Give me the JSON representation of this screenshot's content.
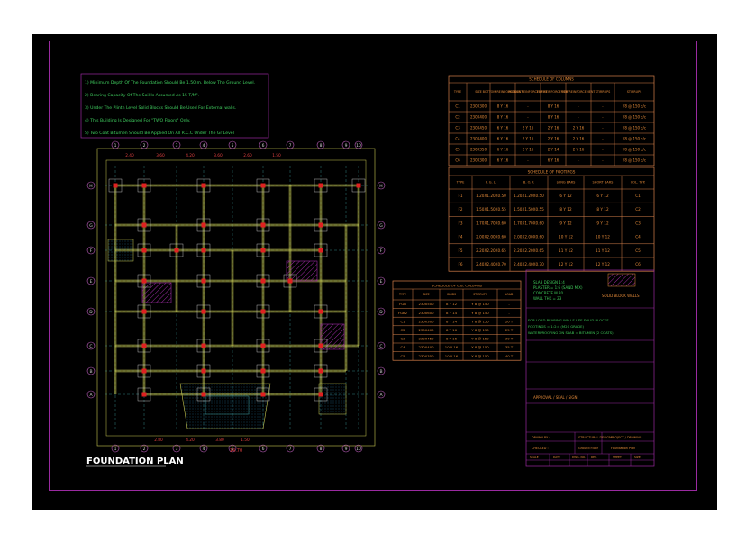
{
  "drawing": {
    "title": "FOUNDATION PLAN"
  },
  "notes": [
    "1)  Minimum Depth Of The Foundation Should Be 1.50 m. Below The Ground Level.",
    "2)  Bearing Capacity Of The Soil Is Assumed As 15 T/M².",
    "3)  Under The Plinth Level Solid Blocks Should Be Used For External walls.",
    "4)  This Building Is Designed For \"TWO Floors\" Only.",
    "5)  Two Coat Bitumen Should Be Applied On All R.C.C Under The Gr Level"
  ],
  "column_schedule": {
    "title": "SCHEDULE OF COLUMNS",
    "headers": [
      "TYPE",
      "SIZE",
      "BOTTOM REINFORCEMENT",
      "MIDDLE REINFORCEMENT",
      "TOP REINFORCEMENT",
      "TOP REINFORCEMENT",
      "STIRRUPS",
      "STIRRUPS"
    ],
    "rows": [
      [
        "C1",
        "230X300",
        "8 Y 16",
        "-",
        "8 Y 16",
        "-",
        "-",
        "Y8 @ 150 c/c"
      ],
      [
        "C2",
        "230X400",
        "8 Y 16",
        "-",
        "8 Y 16",
        "-",
        "-",
        "Y8 @ 150 c/c"
      ],
      [
        "C3",
        "230X450",
        "6 Y 16",
        "2 Y 16",
        "2 Y 16",
        "2 Y 16",
        "-",
        "Y8 @ 150 c/c"
      ],
      [
        "C4",
        "230X400",
        "6 Y 16",
        "2 Y 16",
        "2 Y 16",
        "2 Y 16",
        "-",
        "Y8 @ 150 c/c"
      ],
      [
        "C5",
        "230X350",
        "6 Y 16",
        "2 Y 16",
        "2 Y 14",
        "2 Y 16",
        "-",
        "Y8 @ 150 c/c"
      ],
      [
        "C6",
        "230X300",
        "6 Y 16",
        "-",
        "6 Y 16",
        "-",
        "-",
        "Y8 @ 150 c/c"
      ]
    ]
  },
  "footing_schedule": {
    "title": "SCHEDULE OF FOOTINGS",
    "headers": [
      "TYPE",
      "F. G. L.",
      "B. O. F.",
      "LONG BARS",
      "SHORT BARS",
      "COL. TYP."
    ],
    "rows": [
      [
        "F1",
        "1.20X1.20X0.50",
        "1.20X1.20X0.50",
        "6 Y 12",
        "6 Y 12",
        "C1"
      ],
      [
        "F2",
        "1.50X1.50X0.55",
        "1.50X1.50X0.55",
        "8 Y 12",
        "8 Y 12",
        "C2"
      ],
      [
        "F3",
        "1.70X1.70X0.60",
        "1.70X1.70X0.60",
        "9 Y 12",
        "9 Y 12",
        "C3"
      ],
      [
        "F4",
        "2.00X2.00X0.60",
        "2.00X2.00X0.60",
        "10 Y 12",
        "10 Y 12",
        "C4"
      ],
      [
        "F5",
        "2.20X2.20X0.65",
        "2.20X2.20X0.65",
        "11 Y 12",
        "11 Y 12",
        "C5"
      ],
      [
        "F6",
        "2.40X2.40X0.70",
        "2.40X2.40X0.70",
        "12 Y 12",
        "12 Y 12",
        "C6"
      ]
    ]
  },
  "beam_schedule": {
    "title": "SCHEDULE OF G.B. COLUMNS",
    "headers": [
      "TYPE",
      "SIZE",
      "GRIDS",
      "STIRRUPS",
      "LOAD"
    ],
    "rows": [
      [
        "FGB",
        "230X500",
        "8 Y 12",
        "Y 8 @ 150",
        "-"
      ],
      [
        "FGB2",
        "230X600",
        "8 Y 14",
        "Y 8 @ 150",
        "-"
      ],
      [
        "C1",
        "230X300",
        "8 Y 14",
        "Y 8 @ 150",
        "20 T"
      ],
      [
        "C2",
        "230X400",
        "8 Y 16",
        "Y 8 @ 150",
        "25 T"
      ],
      [
        "C3",
        "230X450",
        "8 Y 16",
        "Y 8 @ 150",
        "30 T"
      ],
      [
        "C4",
        "230X400",
        "10 Y 16",
        "Y 8 @ 150",
        "35 T"
      ],
      [
        "C5",
        "230X350",
        "10 Y 16",
        "Y 8 @ 150",
        "40 T"
      ]
    ]
  },
  "title_block": {
    "slab_notes": [
      "SLAB DESIGN 1:4",
      "PLASTER = 1:6 (SAND MIX)",
      "CONCRETE M 20",
      "WALL THK = 23"
    ],
    "legend_label": "SOLID BLOCK WALLS",
    "general_notes": [
      "FOR LOAD BEARING WALLS USE SOLID BLOCKS",
      "FOOTINGS = 1:2:4 (M20 GRADE)",
      "WATERPROOFING ON SLAB = BITUMEN (2 COATS)"
    ],
    "approval": "APPROVAL / SEAL / SIGN",
    "rows": [
      [
        "DRAWN BY :",
        "STRUCTURAL DESIGN",
        "PROJECT / DRAWING"
      ],
      [
        "CHECKED :",
        "Ground Floor",
        "Foundation Plan"
      ],
      [
        "SCALE",
        "DATE",
        "DWG. NO.",
        "REV.",
        "SHEET",
        "SIZE"
      ]
    ]
  },
  "grid": {
    "cols_top": [
      "1",
      "2",
      "3",
      "4",
      "5",
      "6",
      "7",
      "8",
      "9",
      "10"
    ],
    "rows_side": [
      "A",
      "B",
      "C",
      "D",
      "E",
      "F",
      "G",
      "H"
    ],
    "dims_top": [
      "2.40",
      "3.60",
      "4.20",
      "3.60",
      "2.60",
      "1.50"
    ],
    "dims_bottom": [
      "2.80",
      "4.20",
      "3.80",
      "1.50",
      "14.70"
    ]
  },
  "colors": {
    "background": "#000000",
    "border": "#9a2aa0",
    "table_lines": "#d6804a",
    "text_orange": "#e08838",
    "text_green": "#3ec858",
    "wall": "#c8c850",
    "grid": "#3fa0a0",
    "column_red": "#e02020",
    "hatch": "#9a2aa0",
    "bubble": "#c060c0"
  }
}
